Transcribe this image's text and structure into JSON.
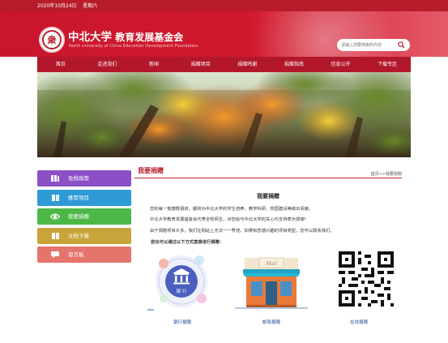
{
  "top_bar": {
    "date_text": "2020年10月24日    星期六"
  },
  "header": {
    "logo_char": "衆",
    "title_main": "中北大学",
    "title_sub": "教育发展基金会",
    "title_en": "North university of China Education Development Foundation",
    "search_placeholder": "请输入您要搜索的内容"
  },
  "nav": {
    "items": [
      "首页",
      "走进我们",
      "新闻",
      "捐赠项目",
      "捐赠鸣谢",
      "捐赠指南",
      "信息公开",
      "下载专区"
    ]
  },
  "sidebar": {
    "items": [
      {
        "label": "免税政策",
        "color": "#8c4fc6",
        "icon": "books-icon"
      },
      {
        "label": "推荐项目",
        "color": "#2e9bd6",
        "icon": "book-icon"
      },
      {
        "label": "我要捐赠",
        "color": "#4db848",
        "icon": "eye-icon"
      },
      {
        "label": "文档下载",
        "color": "#c9a43a",
        "icon": "book-icon"
      },
      {
        "label": "留言板",
        "color": "#e4746c",
        "icon": "message-icon"
      }
    ]
  },
  "content": {
    "section_title": "我要捐赠",
    "breadcrumb": "首页>>我要捐赠",
    "article_title": "我要捐赠",
    "paragraphs": [
      "您的每一笔慷慨捐资，都将为中北大学的学生培养、教学科研、校园建设等做出贡献。",
      "中北大学教育发展基金会代表全校师生，对您给与中北大学的关心与支持表示感谢!",
      "由于捐赠项目众多，我们在网站上无法一一赘述。如果有您感兴趣的项目类型，您可以联系我们。"
    ],
    "methods_heading": "您也可以通过以下方式直接进行捐赠：",
    "methods": [
      {
        "label": "银行捐赠",
        "bank_text": "银 行"
      },
      {
        "label": "邮局捐赠",
        "mail_text": "Mail"
      },
      {
        "label": "在线捐赠"
      }
    ]
  },
  "colors": {
    "brand_red": "#b81c2b",
    "nav_red": "#b3172b",
    "link_blue": "#1f4f93"
  }
}
